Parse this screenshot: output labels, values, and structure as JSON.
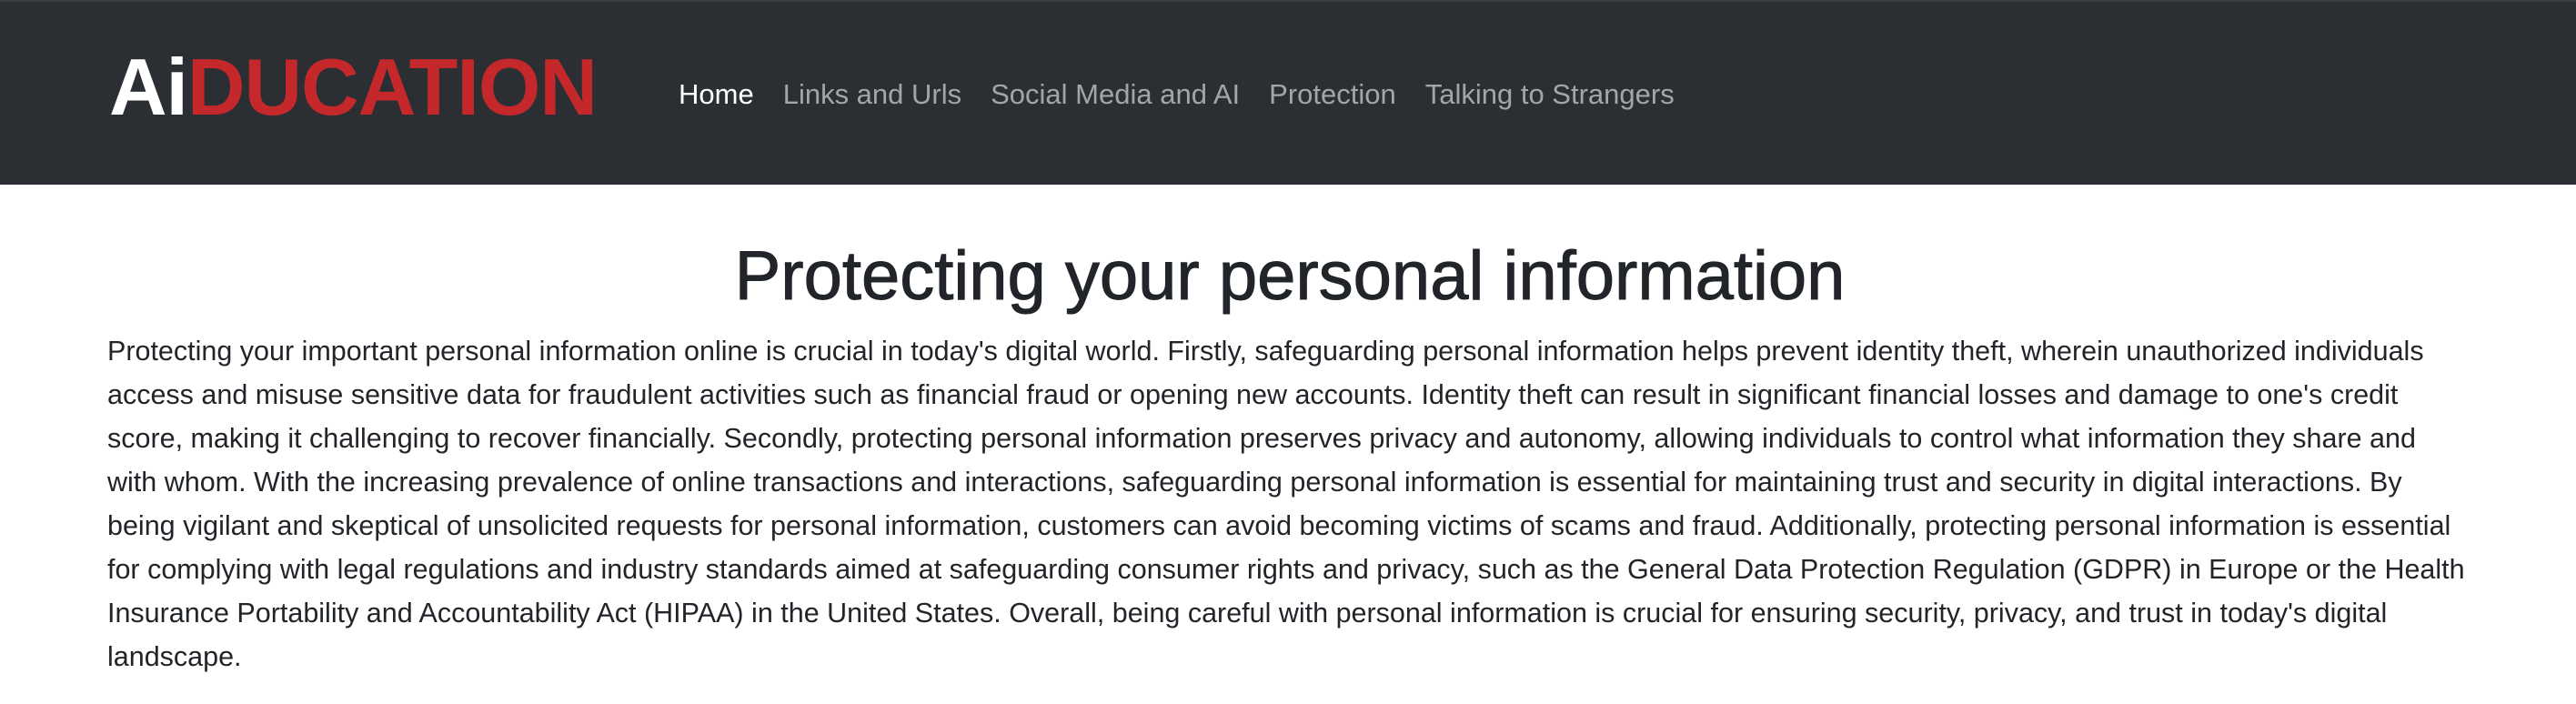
{
  "header": {
    "brand": {
      "part1": "Ai",
      "part2": "DUCATION"
    },
    "nav": [
      {
        "label": "Home",
        "active": true
      },
      {
        "label": "Links and Urls",
        "active": false
      },
      {
        "label": "Social Media and AI",
        "active": false
      },
      {
        "label": "Protection",
        "active": false
      },
      {
        "label": "Talking to Strangers",
        "active": false
      }
    ]
  },
  "main": {
    "title": "Protecting your personal information",
    "paragraph": "Protecting your important personal information online is crucial in today's digital world. Firstly, safeguarding personal information helps prevent identity theft, wherein unauthorized individuals access and misuse sensitive data for fraudulent activities such as financial fraud or opening new accounts. Identity theft can result in significant financial losses and damage to one's credit score, making it challenging to recover financially. Secondly, protecting personal information preserves privacy and autonomy, allowing individuals to control what information they share and with whom. With the increasing prevalence of online transactions and interactions, safeguarding personal information is essential for maintaining trust and security in digital interactions. By being vigilant and skeptical of unsolicited requests for personal information, customers can avoid becoming victims of scams and fraud. Additionally, protecting personal information is essential for complying with legal regulations and industry standards aimed at safeguarding consumer rights and privacy, such as the General Data Protection Regulation (GDPR) in Europe or the Health Insurance Portability and Accountability Act (HIPAA) in the United States. Overall, being careful with personal information is crucial for ensuring security, privacy, and trust in today's digital landscape."
  },
  "colors": {
    "navbar_bg": "#2b2f33",
    "brand_accent": "#c4282a",
    "nav_inactive": "#a3a6a9",
    "nav_active": "#ffffff",
    "text": "#212529"
  }
}
